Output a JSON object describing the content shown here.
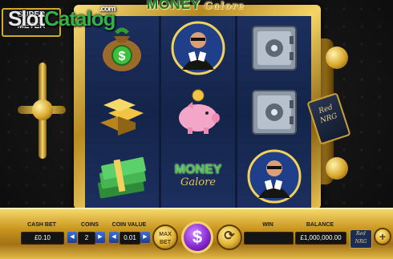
{
  "header": {
    "meter_badge": "SUPER METER",
    "game_logo_main": "MONEY",
    "game_logo_sub": "Galore"
  },
  "watermark": {
    "slot": "Slot",
    "catalog": "Catalog",
    "domain": ".com"
  },
  "tag_label": "Red NRG",
  "reels": [
    [
      "money-bag",
      "gold-bars",
      "cash-stack"
    ],
    [
      "mr-money-portrait",
      "piggy-bank",
      "money-galore-logo"
    ],
    [
      "safe",
      "safe",
      "mr-money-portrait"
    ]
  ],
  "reel_logo_text": {
    "main": "MONEY",
    "sub": "Galore"
  },
  "controls": {
    "cash_bet_label": "CASH BET",
    "cash_bet_value": "£0.10",
    "coins_label": "COINS",
    "coins_value": "2",
    "coin_value_label": "COIN VALUE",
    "coin_value": "0.01",
    "max_bet_label": "MAX BET",
    "spin_symbol": "$",
    "win_label": "WIN",
    "win_value": "",
    "balance_label": "BALANCE",
    "balance_value": "£1,000,000.00",
    "brand_label": "Red NRG",
    "add_label": "+",
    "arrow_left": "◀",
    "arrow_right": "▶"
  },
  "colors": {
    "gold": "#d3a932",
    "reel_bg": "#1c2f5e",
    "spin": "#8a2ad6",
    "logo_green": "#1f7a1f"
  }
}
